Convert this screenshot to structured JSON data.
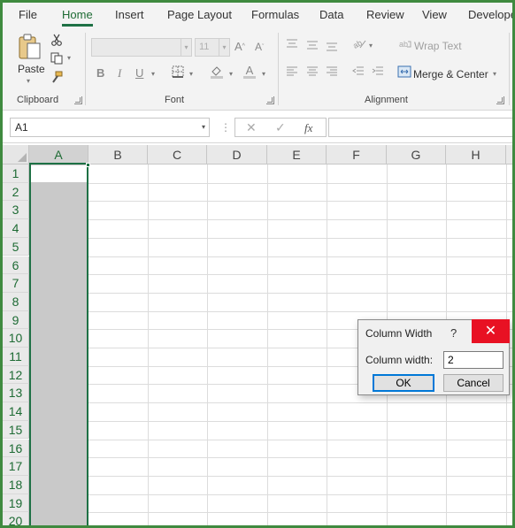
{
  "tabs": [
    "File",
    "Home",
    "Insert",
    "Page Layout",
    "Formulas",
    "Data",
    "Review",
    "View",
    "Developer"
  ],
  "active_tab": "Home",
  "ribbon": {
    "clipboard": {
      "paste_label": "Paste",
      "group_label": "Clipboard"
    },
    "font": {
      "font_name": "",
      "font_size": "11",
      "group_label": "Font",
      "bold": "B",
      "italic": "I",
      "underline": "U"
    },
    "alignment": {
      "wrap_text": "Wrap Text",
      "merge_center": "Merge & Center",
      "group_label": "Alignment"
    }
  },
  "formula_bar": {
    "name_box": "A1",
    "fx": "fx",
    "formula": ""
  },
  "sheet": {
    "columns": [
      "A",
      "B",
      "C",
      "D",
      "E",
      "F",
      "G",
      "H"
    ],
    "rows": [
      "1",
      "2",
      "3",
      "4",
      "5",
      "6",
      "7",
      "8",
      "9",
      "10",
      "11",
      "12",
      "13",
      "14",
      "15",
      "16",
      "17",
      "18",
      "19",
      "20"
    ],
    "selected_column": "A"
  },
  "dialog": {
    "title": "Column Width",
    "help": "?",
    "close": "✕",
    "field_label": "Column width:",
    "field_value": "2",
    "ok": "OK",
    "cancel": "Cancel"
  },
  "colors": {
    "accent": "#1e7145",
    "close": "#e81123",
    "frame": "#3f8a3f"
  }
}
